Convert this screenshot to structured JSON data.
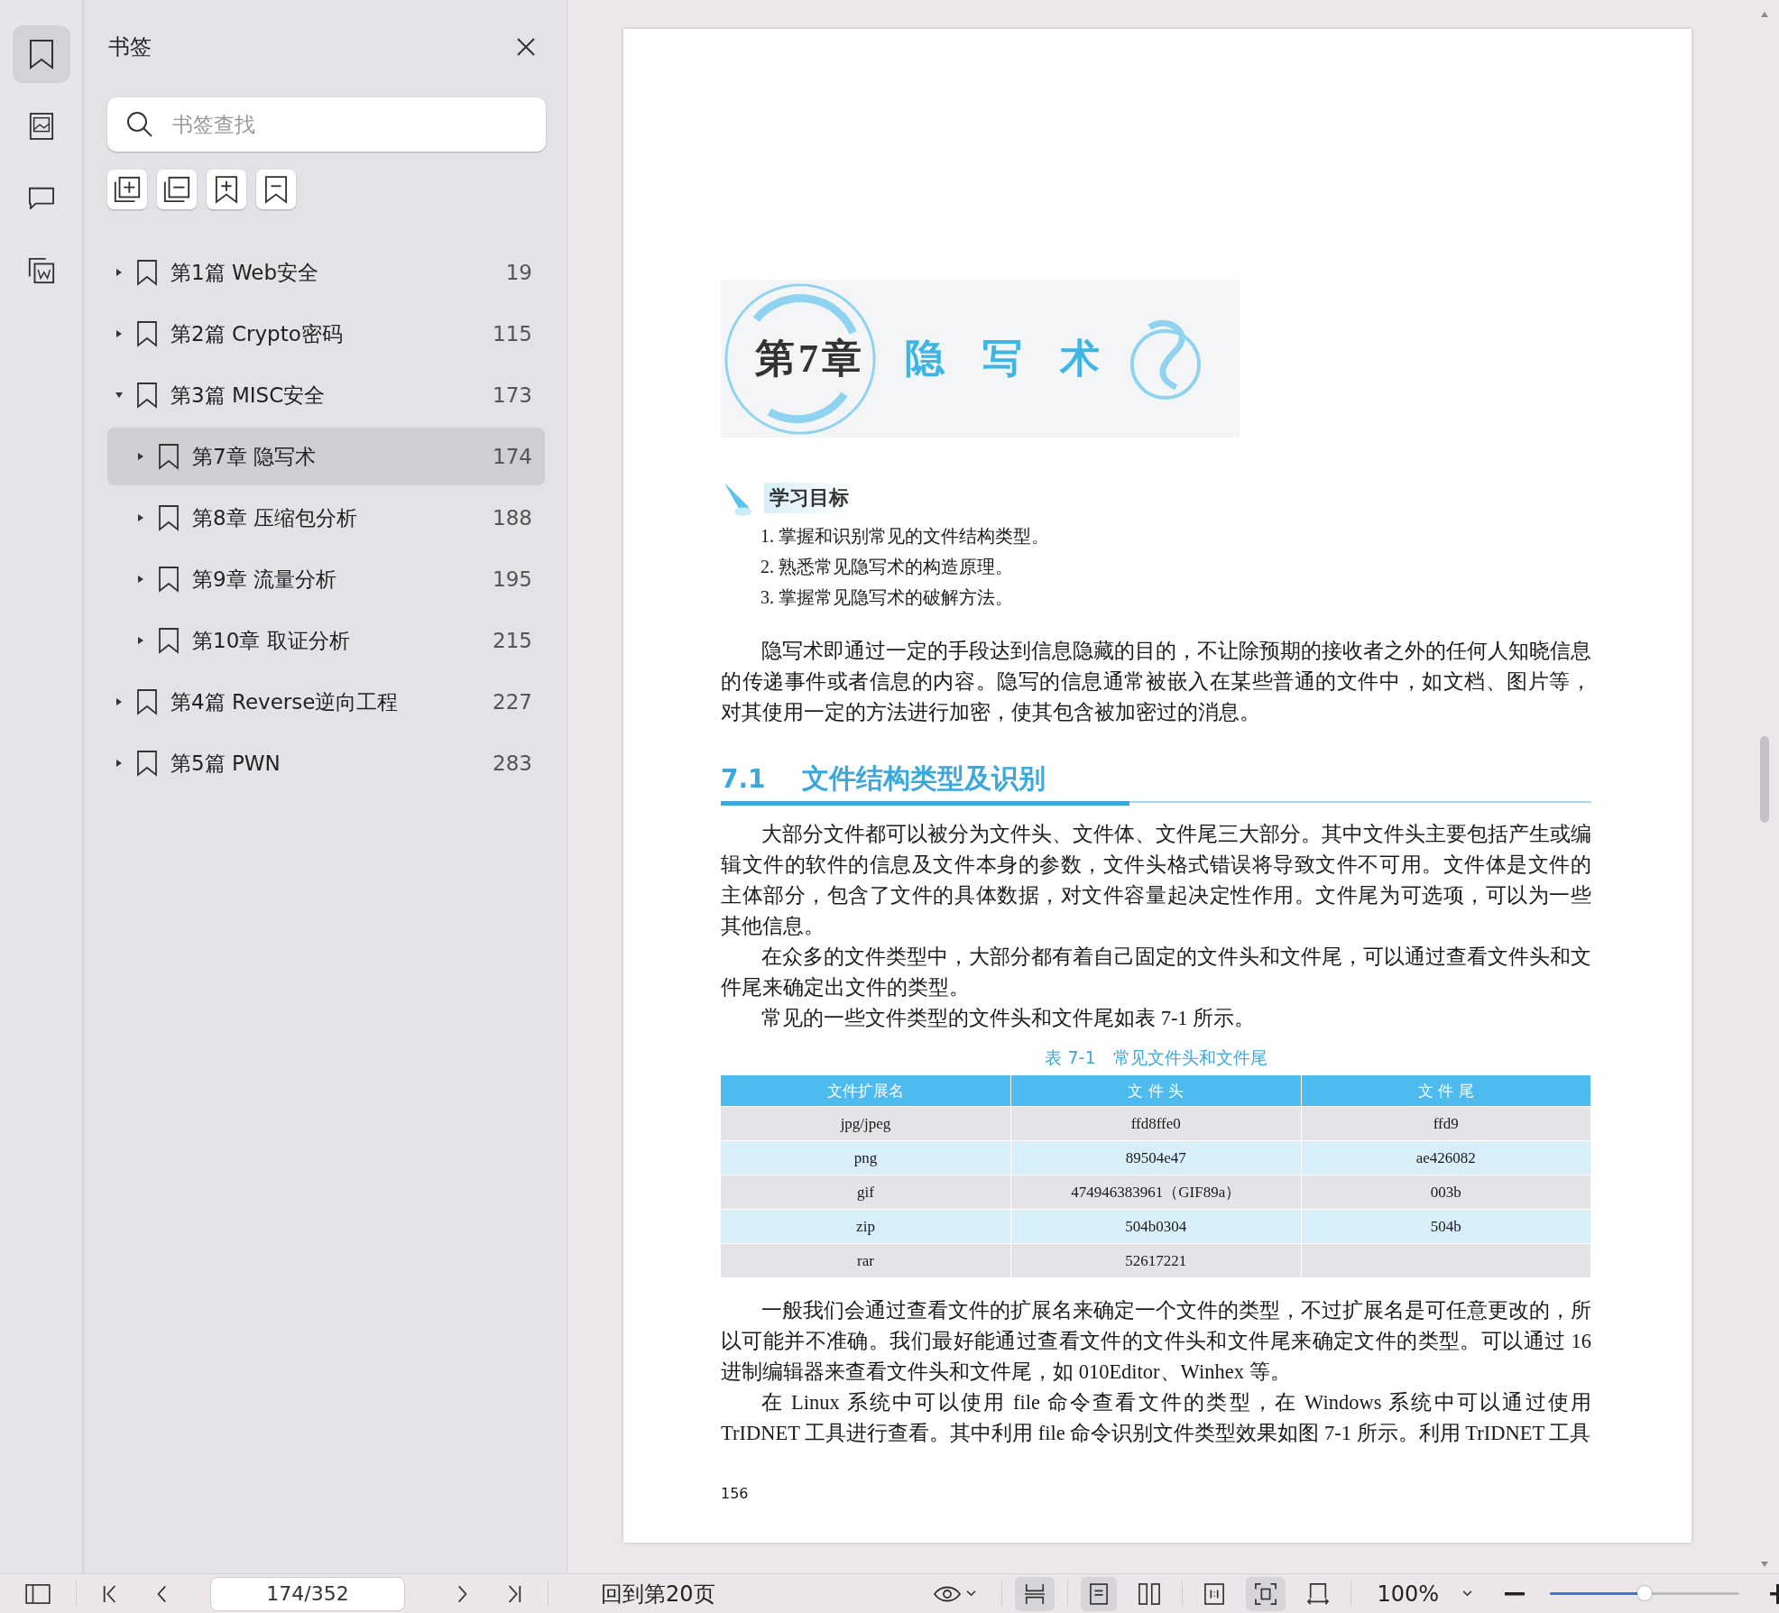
{
  "rail": [
    {
      "kind": "bookmark",
      "selected": true
    },
    {
      "kind": "thumbnail",
      "selected": false
    },
    {
      "kind": "comment",
      "selected": false
    },
    {
      "kind": "attachment",
      "selected": false
    }
  ],
  "sidebar": {
    "title": "书签",
    "search": {
      "placeholder": "书签查找"
    },
    "bookmarks": [
      {
        "label": "第1篇 Web安全",
        "page": "19",
        "expanded": false,
        "selected": false
      },
      {
        "label": "第2篇 Crypto密码",
        "page": "115",
        "expanded": false,
        "selected": false
      },
      {
        "label": "第3篇 MISC安全",
        "page": "173",
        "expanded": true,
        "selected": false,
        "children": [
          {
            "label": "第7章 隐写术",
            "page": "174",
            "expanded": false,
            "selected": true
          },
          {
            "label": "第8章 压缩包分析",
            "page": "188",
            "expanded": false,
            "selected": false
          },
          {
            "label": "第9章 流量分析",
            "page": "195",
            "expanded": false,
            "selected": false
          },
          {
            "label": "第10章 取证分析",
            "page": "215",
            "expanded": false,
            "selected": false
          }
        ]
      },
      {
        "label": "第4篇 Reverse逆向工程",
        "page": "227",
        "expanded": false,
        "selected": false
      },
      {
        "label": "第5篇 PWN",
        "page": "283",
        "expanded": false,
        "selected": false
      }
    ]
  },
  "document": {
    "chapter_number": "第7章",
    "chapter_title": "隐写术",
    "objectives_title": "学习目标",
    "objectives": [
      "1. 掌握和识别常见的文件结构类型。",
      "2. 熟悉常见隐写术的构造原理。",
      "3. 掌握常见隐写术的破解方法。"
    ],
    "intro_paragraphs": [
      "隐写术即通过一定的手段达到信息隐藏的目的，不让除预期的接收者之外的任何人知晓信息的传递事件或者信息的内容。隐写的信息通常被嵌入在某些普通的文件中，如文档、图片等，对其使用一定的方法进行加密，使其包含被加密过的消息。"
    ],
    "section": {
      "number": "7.1",
      "title": "文件结构类型及识别"
    },
    "paragraphs": [
      "大部分文件都可以被分为文件头、文件体、文件尾三大部分。其中文件头主要包括产生或编辑文件的软件的信息及文件本身的参数，文件头格式错误将导致文件不可用。文件体是文件的主体部分，包含了文件的具体数据，对文件容量起决定性作用。文件尾为可选项，可以为一些其他信息。",
      "在众多的文件类型中，大部分都有着自己固定的文件头和文件尾，可以通过查看文件头和文件尾来确定出文件的类型。",
      "常见的一些文件类型的文件头和文件尾如表 7-1 所示。"
    ],
    "table": {
      "caption": "表 7-1　常见文件头和文件尾",
      "columns": [
        "文件扩展名",
        "文 件 头",
        "文 件 尾"
      ],
      "rows": [
        {
          "extension": "jpg/jpeg",
          "header": "ffd8ffe0",
          "trailer": "ffd9"
        },
        {
          "extension": "png",
          "header": "89504e47",
          "trailer": "ae426082"
        },
        {
          "extension": "gif",
          "header": "474946383961（GIF89a）",
          "trailer": "003b"
        },
        {
          "extension": "zip",
          "header": "504b0304",
          "trailer": "504b"
        },
        {
          "extension": "rar",
          "header": "52617221"
        }
      ]
    },
    "after_paragraphs": [
      "一般我们会通过查看文件的扩展名来确定一个文件的类型，不过扩展名是可任意更改的，所以可能并不准确。我们最好能通过查看文件的文件头和文件尾来确定文件的类型。可以通过 16 进制编辑器来查看文件头和文件尾，如 010Editor、Winhex 等。",
      "在 Linux 系统中可以使用 file 命令查看文件的类型，在 Windows 系统中可以通过使用 TrIDNET 工具进行查看。其中利用 file 命令识别文件类型效果如图 7-1 所示。利用 TrIDNET 工具"
    ],
    "page_number": "156"
  },
  "toolbar": {
    "page_input": {
      "value": "174/352"
    },
    "goto_link": "回到第20页",
    "view_tools": [
      {
        "kind": "scroll",
        "on": true
      },
      {
        "kind": "single",
        "on": true
      },
      {
        "kind": "double",
        "on": false
      },
      {
        "kind": "actual",
        "on": false
      },
      {
        "kind": "fit",
        "on": true
      },
      {
        "kind": "width",
        "on": false
      }
    ],
    "zoom": {
      "value": "100%",
      "level": 0.5
    }
  }
}
